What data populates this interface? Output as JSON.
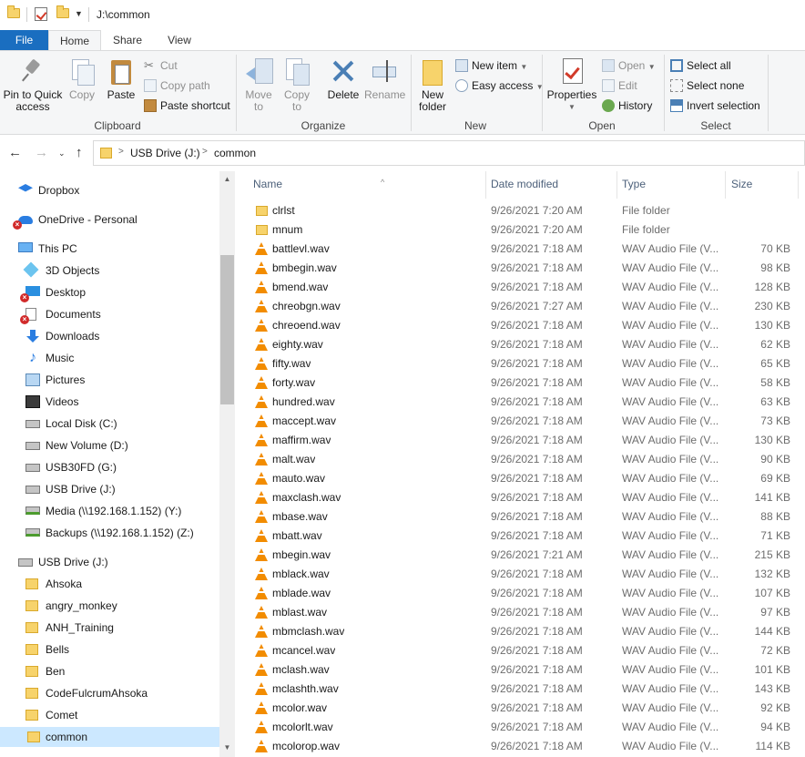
{
  "titlebar": {
    "path": "J:\\common"
  },
  "tabs": [
    "File",
    "Home",
    "Share",
    "View"
  ],
  "ribbon": {
    "clipboard": {
      "label": "Clipboard",
      "pin": "Pin to Quick\naccess",
      "copy": "Copy",
      "paste": "Paste",
      "cut": "Cut",
      "copy_path": "Copy path",
      "paste_shortcut": "Paste shortcut"
    },
    "organize": {
      "label": "Organize",
      "move_to": "Move\nto",
      "copy_to": "Copy\nto",
      "delete": "Delete",
      "rename": "Rename"
    },
    "new": {
      "label": "New",
      "new_folder": "New\nfolder",
      "new_item": "New item",
      "easy_access": "Easy access"
    },
    "open": {
      "label": "Open",
      "properties": "Properties",
      "open": "Open",
      "edit": "Edit",
      "history": "History"
    },
    "select": {
      "label": "Select",
      "select_all": "Select all",
      "select_none": "Select none",
      "invert": "Invert selection"
    }
  },
  "address": {
    "crumbs": [
      "USB Drive (J:)",
      "common"
    ]
  },
  "nav": {
    "dropbox": "Dropbox",
    "onedrive": "OneDrive - Personal",
    "this_pc": "This PC",
    "objects3d": "3D Objects",
    "desktop": "Desktop",
    "documents": "Documents",
    "downloads": "Downloads",
    "music": "Music",
    "pictures": "Pictures",
    "videos": "Videos",
    "local_disk": "Local Disk (C:)",
    "new_volume": "New Volume (D:)",
    "usb30fd": "USB30FD (G:)",
    "usb_drive": "USB Drive (J:)",
    "media": "Media (\\\\192.168.1.152) (Y:)",
    "backups": "Backups (\\\\192.168.1.152) (Z:)",
    "usb_drive2": "USB Drive (J:)",
    "folders": [
      "Ahsoka",
      "angry_monkey",
      "ANH_Training",
      "Bells",
      "Ben",
      "CodeFulcrumAhsoka",
      "Comet",
      "common"
    ]
  },
  "columns": {
    "name": "Name",
    "date": "Date modified",
    "type": "Type",
    "size": "Size"
  },
  "files": [
    {
      "name": "clrlst",
      "date": "9/26/2021 7:20 AM",
      "type": "File folder",
      "size": "",
      "kind": "folder"
    },
    {
      "name": "mnum",
      "date": "9/26/2021 7:20 AM",
      "type": "File folder",
      "size": "",
      "kind": "folder"
    },
    {
      "name": "battlevl.wav",
      "date": "9/26/2021 7:18 AM",
      "type": "WAV Audio File (V...",
      "size": "70 KB",
      "kind": "wav"
    },
    {
      "name": "bmbegin.wav",
      "date": "9/26/2021 7:18 AM",
      "type": "WAV Audio File (V...",
      "size": "98 KB",
      "kind": "wav"
    },
    {
      "name": "bmend.wav",
      "date": "9/26/2021 7:18 AM",
      "type": "WAV Audio File (V...",
      "size": "128 KB",
      "kind": "wav"
    },
    {
      "name": "chreobgn.wav",
      "date": "9/26/2021 7:27 AM",
      "type": "WAV Audio File (V...",
      "size": "230 KB",
      "kind": "wav"
    },
    {
      "name": "chreoend.wav",
      "date": "9/26/2021 7:18 AM",
      "type": "WAV Audio File (V...",
      "size": "130 KB",
      "kind": "wav"
    },
    {
      "name": "eighty.wav",
      "date": "9/26/2021 7:18 AM",
      "type": "WAV Audio File (V...",
      "size": "62 KB",
      "kind": "wav"
    },
    {
      "name": "fifty.wav",
      "date": "9/26/2021 7:18 AM",
      "type": "WAV Audio File (V...",
      "size": "65 KB",
      "kind": "wav"
    },
    {
      "name": "forty.wav",
      "date": "9/26/2021 7:18 AM",
      "type": "WAV Audio File (V...",
      "size": "58 KB",
      "kind": "wav"
    },
    {
      "name": "hundred.wav",
      "date": "9/26/2021 7:18 AM",
      "type": "WAV Audio File (V...",
      "size": "63 KB",
      "kind": "wav"
    },
    {
      "name": "maccept.wav",
      "date": "9/26/2021 7:18 AM",
      "type": "WAV Audio File (V...",
      "size": "73 KB",
      "kind": "wav"
    },
    {
      "name": "maffirm.wav",
      "date": "9/26/2021 7:18 AM",
      "type": "WAV Audio File (V...",
      "size": "130 KB",
      "kind": "wav"
    },
    {
      "name": "malt.wav",
      "date": "9/26/2021 7:18 AM",
      "type": "WAV Audio File (V...",
      "size": "90 KB",
      "kind": "wav"
    },
    {
      "name": "mauto.wav",
      "date": "9/26/2021 7:18 AM",
      "type": "WAV Audio File (V...",
      "size": "69 KB",
      "kind": "wav"
    },
    {
      "name": "maxclash.wav",
      "date": "9/26/2021 7:18 AM",
      "type": "WAV Audio File (V...",
      "size": "141 KB",
      "kind": "wav"
    },
    {
      "name": "mbase.wav",
      "date": "9/26/2021 7:18 AM",
      "type": "WAV Audio File (V...",
      "size": "88 KB",
      "kind": "wav"
    },
    {
      "name": "mbatt.wav",
      "date": "9/26/2021 7:18 AM",
      "type": "WAV Audio File (V...",
      "size": "71 KB",
      "kind": "wav"
    },
    {
      "name": "mbegin.wav",
      "date": "9/26/2021 7:21 AM",
      "type": "WAV Audio File (V...",
      "size": "215 KB",
      "kind": "wav"
    },
    {
      "name": "mblack.wav",
      "date": "9/26/2021 7:18 AM",
      "type": "WAV Audio File (V...",
      "size": "132 KB",
      "kind": "wav"
    },
    {
      "name": "mblade.wav",
      "date": "9/26/2021 7:18 AM",
      "type": "WAV Audio File (V...",
      "size": "107 KB",
      "kind": "wav"
    },
    {
      "name": "mblast.wav",
      "date": "9/26/2021 7:18 AM",
      "type": "WAV Audio File (V...",
      "size": "97 KB",
      "kind": "wav"
    },
    {
      "name": "mbmclash.wav",
      "date": "9/26/2021 7:18 AM",
      "type": "WAV Audio File (V...",
      "size": "144 KB",
      "kind": "wav"
    },
    {
      "name": "mcancel.wav",
      "date": "9/26/2021 7:18 AM",
      "type": "WAV Audio File (V...",
      "size": "72 KB",
      "kind": "wav"
    },
    {
      "name": "mclash.wav",
      "date": "9/26/2021 7:18 AM",
      "type": "WAV Audio File (V...",
      "size": "101 KB",
      "kind": "wav"
    },
    {
      "name": "mclashth.wav",
      "date": "9/26/2021 7:18 AM",
      "type": "WAV Audio File (V...",
      "size": "143 KB",
      "kind": "wav"
    },
    {
      "name": "mcolor.wav",
      "date": "9/26/2021 7:18 AM",
      "type": "WAV Audio File (V...",
      "size": "92 KB",
      "kind": "wav"
    },
    {
      "name": "mcolorlt.wav",
      "date": "9/26/2021 7:18 AM",
      "type": "WAV Audio File (V...",
      "size": "94 KB",
      "kind": "wav"
    },
    {
      "name": "mcolorop.wav",
      "date": "9/26/2021 7:18 AM",
      "type": "WAV Audio File (V...",
      "size": "114 KB",
      "kind": "wav"
    }
  ],
  "colors": {
    "file_tab": "#1a6ec0",
    "selection": "#cce8ff",
    "folder": "#f7d36b",
    "vlc_cone": "#f28c00"
  }
}
